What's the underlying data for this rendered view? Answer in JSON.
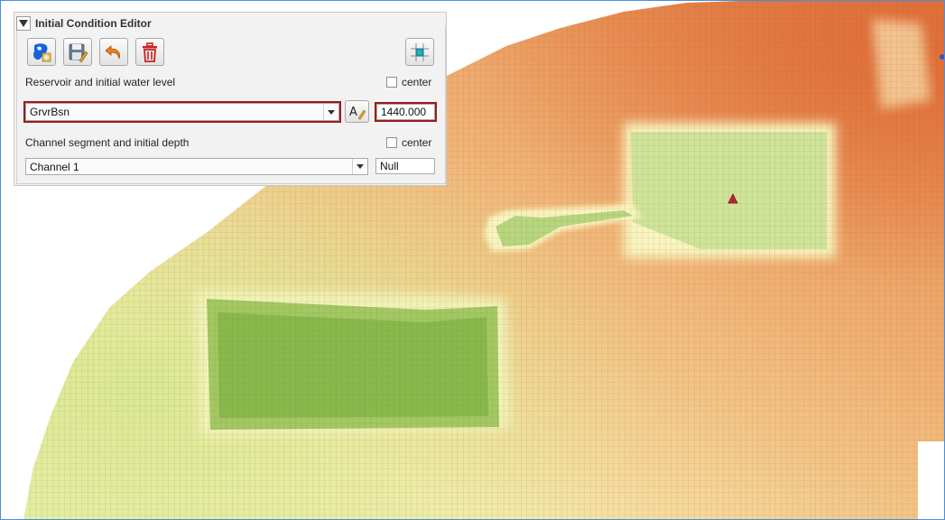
{
  "colors": {
    "highlight": "#a01818",
    "map_low": "#6fae3c",
    "map_mid": "#f7f0b0",
    "map_high": "#e37740",
    "marker": "#e02020"
  },
  "panel": {
    "title": "Initial Condition Editor",
    "toolbar": {
      "buttons": [
        {
          "icon": "add-reservoir-icon"
        },
        {
          "icon": "save-edit-icon"
        },
        {
          "icon": "undo-icon"
        },
        {
          "icon": "delete-icon"
        },
        {
          "icon": "map-selection-icon"
        }
      ]
    },
    "reservoir": {
      "label": "Reservoir and initial water level",
      "center_label": "center",
      "center_checked": false,
      "selected": "GrvrBsn",
      "water_level": "1440.000"
    },
    "channel": {
      "label": "Channel segment and initial depth",
      "center_label": "center",
      "center_checked": false,
      "selected": "Channel 1",
      "depth": "Null"
    }
  }
}
